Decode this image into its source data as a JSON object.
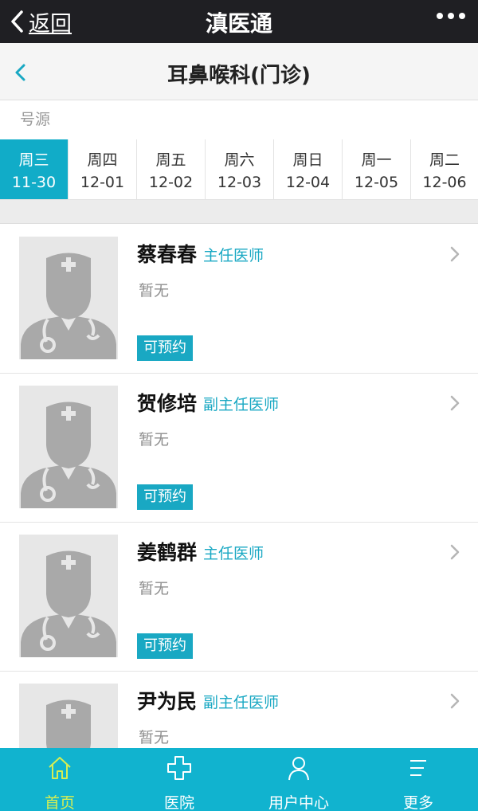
{
  "topbar": {
    "back_label": "返回",
    "title": "滇医通"
  },
  "subheader": {
    "title": "耳鼻喉科(门诊)"
  },
  "source": {
    "label": "号源"
  },
  "date_tabs": [
    {
      "weekday": "周三",
      "date": "11-30",
      "active": true
    },
    {
      "weekday": "周四",
      "date": "12-01",
      "active": false
    },
    {
      "weekday": "周五",
      "date": "12-02",
      "active": false
    },
    {
      "weekday": "周六",
      "date": "12-03",
      "active": false
    },
    {
      "weekday": "周日",
      "date": "12-04",
      "active": false
    },
    {
      "weekday": "周一",
      "date": "12-05",
      "active": false
    },
    {
      "weekday": "周二",
      "date": "12-06",
      "active": false
    }
  ],
  "doctors": [
    {
      "name": "蔡春春",
      "title": "主任医师",
      "note": "暂无",
      "action": "可预约"
    },
    {
      "name": "贺修培",
      "title": "副主任医师",
      "note": "暂无",
      "action": "可预约"
    },
    {
      "name": "姜鹤群",
      "title": "主任医师",
      "note": "暂无",
      "action": "可预约"
    },
    {
      "name": "尹为民",
      "title": "副主任医师",
      "note": "暂无",
      "action": ""
    }
  ],
  "bottom_nav": [
    {
      "label": "首页",
      "icon": "home-icon",
      "active": true
    },
    {
      "label": "医院",
      "icon": "hospital-cross-icon",
      "active": false
    },
    {
      "label": "用户中心",
      "icon": "user-icon",
      "active": false
    },
    {
      "label": "更多",
      "icon": "menu-icon",
      "active": false
    }
  ],
  "colors": {
    "accent": "#11acc8",
    "topbar": "#1f1f23",
    "nav_active": "#d7ee52"
  }
}
